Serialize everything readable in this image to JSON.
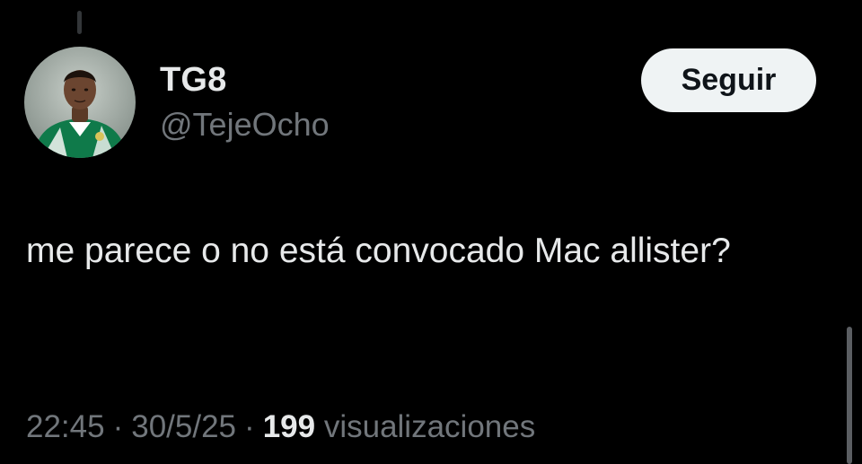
{
  "author": {
    "display_name": "TG8",
    "handle": "@TejeOcho",
    "avatar_icon": "profile-photo-icon"
  },
  "actions": {
    "follow_label": "Seguir"
  },
  "tweet": {
    "text": "me parece o no está convocado Mac allister?",
    "time": "22:45",
    "date": "30/5/25",
    "views_count": "199",
    "views_label": "visualizaciones",
    "separator": "·"
  },
  "colors": {
    "background": "#000000",
    "primary_text": "#e7e9ea",
    "secondary_text": "#71767b",
    "button_bg": "#eff3f4",
    "button_text": "#0f1419"
  }
}
